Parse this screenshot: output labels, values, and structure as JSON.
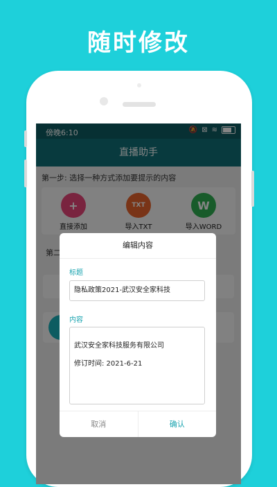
{
  "headline": "随时修改",
  "status_bar": {
    "time": "傍晚6:10",
    "icons": [
      "mute-icon",
      "sim-icon",
      "wifi-icon",
      "battery-icon"
    ]
  },
  "app_bar": {
    "title": "直播助手"
  },
  "step1": {
    "label": "第一步: 选择一种方式添加要提示的内容",
    "actions": [
      {
        "label": "直接添加",
        "icon": "plus-icon",
        "color": "#E8457A"
      },
      {
        "label": "导入TXT",
        "icon": "txt-file-icon",
        "color": "#E8642C"
      },
      {
        "label": "导入WORD",
        "icon": "word-icon",
        "color": "#2FAE52"
      }
    ]
  },
  "step2": {
    "label_partial": "第二"
  },
  "dialog": {
    "title": "编辑内容",
    "title_label": "标题",
    "title_value": "隐私政策2021-武汉安全家科技",
    "content_label": "内容",
    "content_lines": [
      "武汉安全家科技服务有限公司",
      "修订时间: 2021-6-21"
    ],
    "cancel": "取消",
    "confirm": "确认"
  },
  "colors": {
    "background": "#1ED0DA",
    "appbar": "#107078",
    "accent": "#1BA4B0"
  }
}
